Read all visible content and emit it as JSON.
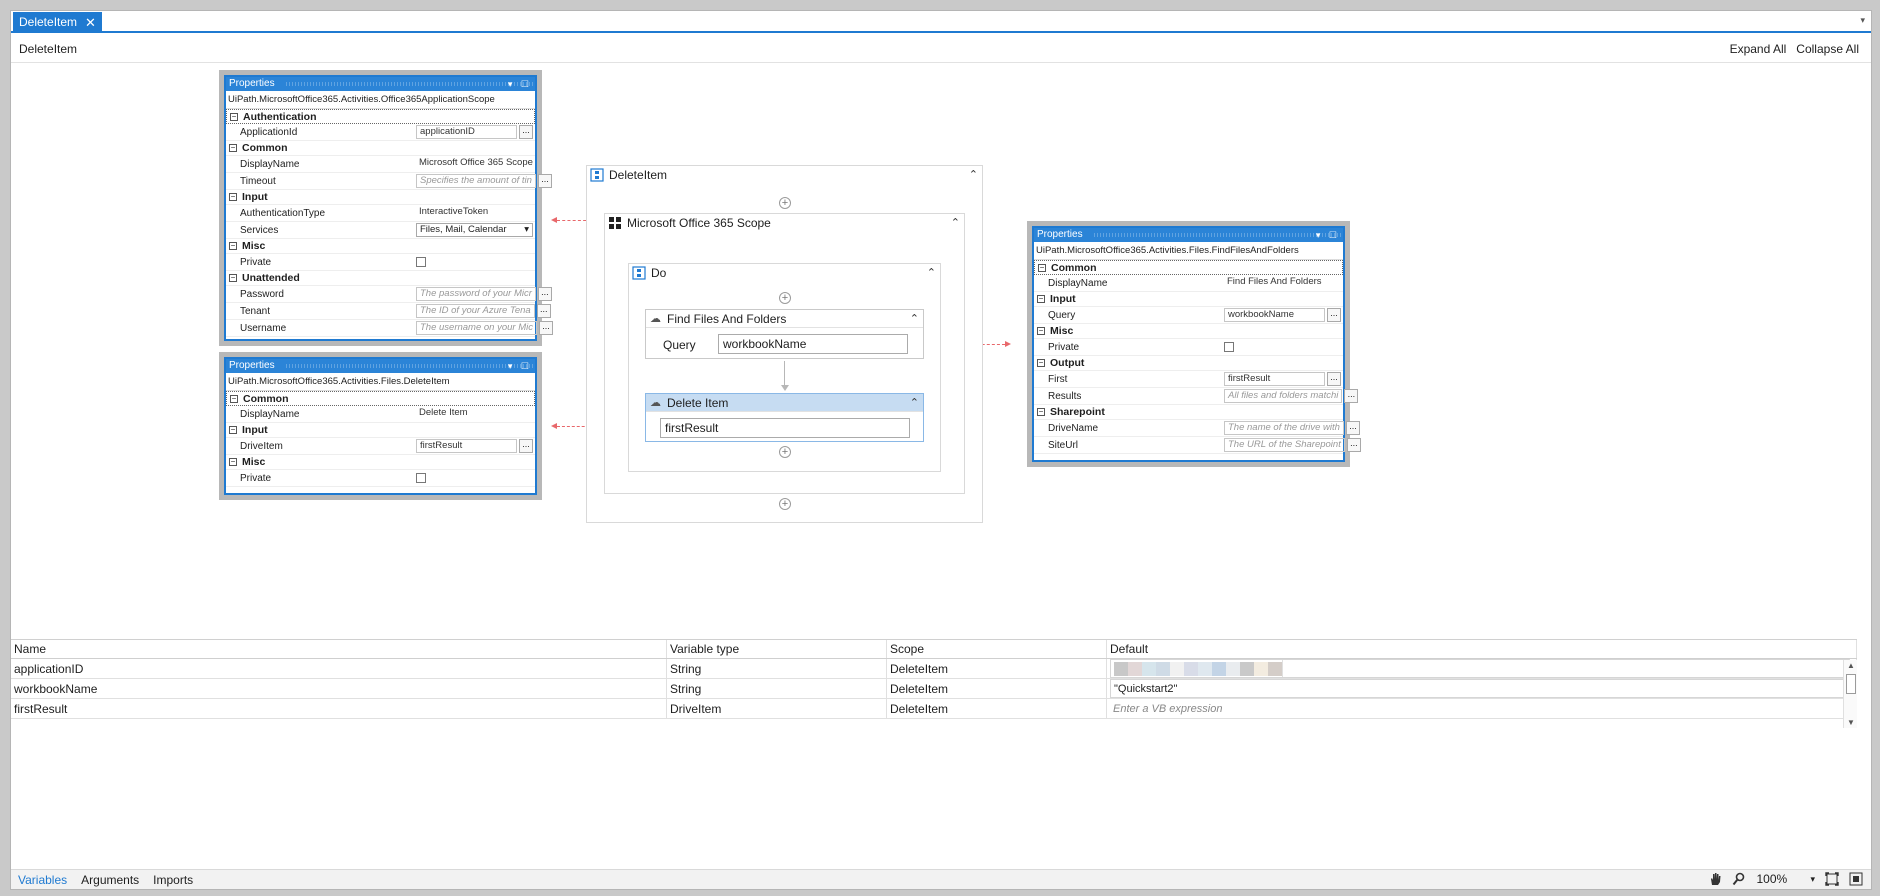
{
  "tab": {
    "title": "DeleteItem",
    "close": "✕",
    "dropdown": "▾"
  },
  "header": {
    "breadcrumb": "DeleteItem",
    "expand_all": "Expand All",
    "collapse_all": "Collapse All"
  },
  "panel1": {
    "title": "Properties",
    "title_icons": "▾ ☐",
    "class": "UiPath.MicrosoftOffice365.Activities.Office365ApplicationScope",
    "categories": [
      {
        "name": "Authentication",
        "rows": [
          {
            "name": "ApplicationId",
            "value": "applicationID",
            "placeholder": false,
            "btn": true
          }
        ]
      },
      {
        "name": "Common",
        "rows": [
          {
            "name": "DisplayName",
            "value": "Microsoft Office 365 Scope",
            "plain": true
          },
          {
            "name": "Timeout",
            "value": "Specifies the amount of tin",
            "placeholder": true,
            "btn": true
          }
        ]
      },
      {
        "name": "Input",
        "rows": [
          {
            "name": "AuthenticationType",
            "value": "InteractiveToken",
            "plain": true
          },
          {
            "name": "Services",
            "value": "Files, Mail, Calendar",
            "select": true
          }
        ]
      },
      {
        "name": "Misc",
        "rows": [
          {
            "name": "Private",
            "checkbox": true
          }
        ]
      },
      {
        "name": "Unattended",
        "rows": [
          {
            "name": "Password",
            "value": "The password of your Micr",
            "placeholder": true,
            "btn": true
          },
          {
            "name": "Tenant",
            "value": "The ID of your Azure Tena",
            "placeholder": true,
            "btn": true
          },
          {
            "name": "Username",
            "value": "The username on your Mic",
            "placeholder": true,
            "btn": true
          }
        ]
      }
    ]
  },
  "panel2": {
    "title": "Properties",
    "title_icons": "▾ ☐",
    "class": "UiPath.MicrosoftOffice365.Activities.Files.DeleteItem",
    "categories": [
      {
        "name": "Common",
        "rows": [
          {
            "name": "DisplayName",
            "value": "Delete Item",
            "plain": true
          }
        ]
      },
      {
        "name": "Input",
        "rows": [
          {
            "name": "DriveItem",
            "value": "firstResult",
            "btn": true
          }
        ]
      },
      {
        "name": "Misc",
        "rows": [
          {
            "name": "Private",
            "checkbox": true
          }
        ]
      }
    ]
  },
  "panel3": {
    "title": "Properties",
    "title_icons": "▾ ☐",
    "class": "UiPath.MicrosoftOffice365.Activities.Files.FindFilesAndFolders",
    "categories": [
      {
        "name": "Common",
        "rows": [
          {
            "name": "DisplayName",
            "value": "Find Files And Folders",
            "plain": true
          }
        ]
      },
      {
        "name": "Input",
        "rows": [
          {
            "name": "Query",
            "value": "workbookName",
            "btn": true
          }
        ]
      },
      {
        "name": "Misc",
        "rows": [
          {
            "name": "Private",
            "checkbox": true
          }
        ]
      },
      {
        "name": "Output",
        "rows": [
          {
            "name": "First",
            "value": "firstResult",
            "btn": true
          },
          {
            "name": "Results",
            "value": "All files and folders matchi",
            "placeholder": true,
            "btn": true
          }
        ]
      },
      {
        "name": "Sharepoint",
        "rows": [
          {
            "name": "DriveName",
            "value": "The name of the drive with",
            "placeholder": true,
            "btn": true
          },
          {
            "name": "SiteUrl",
            "value": "The URL of the Sharepoint",
            "placeholder": true,
            "btn": true
          }
        ]
      }
    ]
  },
  "workflow": {
    "sequence": "DeleteItem",
    "scope": "Microsoft Office 365 Scope",
    "do": "Do",
    "find": {
      "title": "Find Files And Folders",
      "label": "Query",
      "value": "workbookName"
    },
    "delete": {
      "title": "Delete Item",
      "value": "firstResult"
    },
    "plus": "+",
    "collapse": "⌃"
  },
  "variables": {
    "headers": [
      "Name",
      "Variable type",
      "Scope",
      "Default"
    ],
    "rows": [
      {
        "name": "applicationID",
        "type": "String",
        "scope": "DeleteItem",
        "default": "",
        "blurred": true
      },
      {
        "name": "workbookName",
        "type": "String",
        "scope": "DeleteItem",
        "default": "\"Quickstart2\""
      },
      {
        "name": "firstResult",
        "type": "DriveItem",
        "scope": "DeleteItem",
        "default": "Enter a VB expression",
        "placeholder": true
      }
    ]
  },
  "bottom": {
    "tabs": [
      "Variables",
      "Arguments",
      "Imports"
    ],
    "zoom": "100%",
    "icons": [
      "hand-icon",
      "search-icon",
      "fit-screen-icon",
      "overview-icon"
    ]
  },
  "colors": {
    "accent": "#1f7ad1",
    "selected": "#c6dcf2",
    "connector": "#e8686b"
  }
}
